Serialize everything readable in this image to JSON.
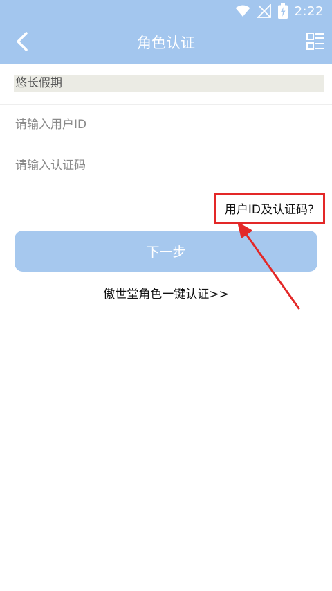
{
  "status_bar": {
    "time": "2:22",
    "icons": [
      "wifi-icon",
      "no-signal-icon",
      "battery-charging-icon"
    ]
  },
  "app_bar": {
    "title": "角色认证",
    "back_icon": "chevron-left-icon",
    "menu_icon": "list-menu-icon"
  },
  "form": {
    "account_name": "悠长假期",
    "user_id": {
      "value": "",
      "placeholder": "请输入用户ID"
    },
    "auth_code": {
      "value": "",
      "placeholder": "请输入认证码"
    }
  },
  "help_link": "用户ID及认证码?",
  "next_button": "下一步",
  "one_click_link": "傲世堂角色一键认证>>",
  "colors": {
    "header": "#a3c6ee",
    "button": "#a6c8ee",
    "annotation": "#e32828"
  }
}
